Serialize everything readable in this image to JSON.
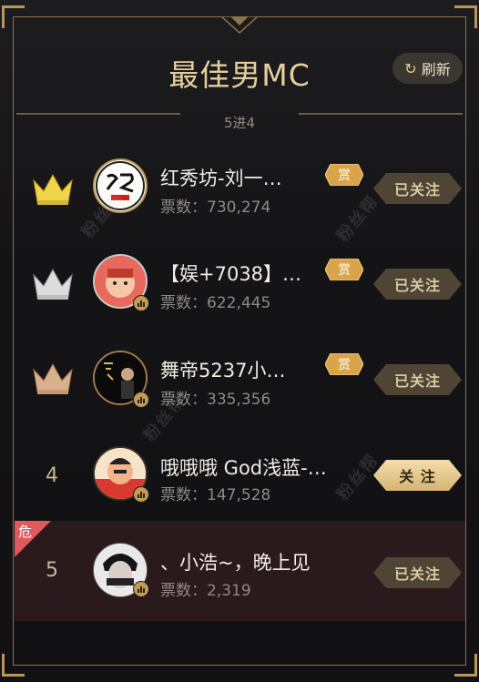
{
  "header": {
    "title": "最佳男MC",
    "refresh_label": "刷新",
    "round_label": "5进4"
  },
  "rows": [
    {
      "rank": 1,
      "rank_style": "gold-crown",
      "name": "红秀坊-刘一…",
      "votes_label": "票数：",
      "votes": "730,274",
      "reward_label": "赏",
      "follow_label": "已关注",
      "followed": true
    },
    {
      "rank": 2,
      "rank_style": "silver-crown",
      "name": "【娱+7038】…",
      "votes_label": "票数：",
      "votes": "622,445",
      "reward_label": "赏",
      "follow_label": "已关注",
      "followed": true
    },
    {
      "rank": 3,
      "rank_style": "bronze-crown",
      "name": "舞帝5237小…",
      "votes_label": "票数：",
      "votes": "335,356",
      "reward_label": "赏",
      "follow_label": "已关注",
      "followed": true
    },
    {
      "rank": 4,
      "rank_text": "4",
      "name": "哦哦哦 God浅蓝-…",
      "votes_label": "票数：",
      "votes": "147,528",
      "follow_label": "关 注",
      "followed": false
    },
    {
      "rank": 5,
      "rank_text": "5",
      "name": "、小浩~，晚上见",
      "votes_label": "票数：",
      "votes": "2,319",
      "follow_label": "已关注",
      "followed": true,
      "danger_label": "危"
    }
  ],
  "watermark_text": "粉丝帮",
  "colors": {
    "accent_gold": "#e5cf9a",
    "frame_gold": "#8c7448",
    "danger": "#e0595b"
  }
}
